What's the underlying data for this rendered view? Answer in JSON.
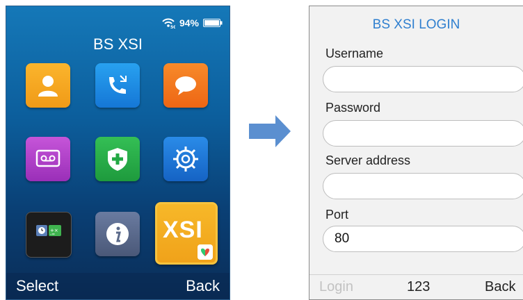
{
  "home": {
    "status": {
      "battery_percent": "94%",
      "network_label": "5G"
    },
    "title": "BS XSI",
    "apps": [
      {
        "name": "contacts-app",
        "icon": "contacts-icon",
        "color": "#f4a91e"
      },
      {
        "name": "call-history-app",
        "icon": "call-history-icon",
        "color": "#1b8de3"
      },
      {
        "name": "messages-app",
        "icon": "messages-icon",
        "color": "#f2751d"
      },
      {
        "name": "voicemail-app",
        "icon": "voicemail-icon",
        "color": "#b040c8"
      },
      {
        "name": "emergency-app",
        "icon": "shield-plus-icon",
        "color": "#2fb14c"
      },
      {
        "name": "settings-app",
        "icon": "gear-icon",
        "color": "#1e7bd8"
      },
      {
        "name": "tools-app",
        "icon": "clock-calculator-icon",
        "color": "#1a1a1a"
      },
      {
        "name": "info-app",
        "icon": "info-icon",
        "color": "#5b6a8a"
      }
    ],
    "xsi_app": {
      "label": "XSI",
      "icon": "xsi-icon"
    },
    "softkeys": {
      "left": "Select",
      "right": "Back"
    }
  },
  "login": {
    "title": "BS XSI LOGIN",
    "fields": [
      {
        "label": "Username",
        "value": ""
      },
      {
        "label": "Password",
        "value": ""
      },
      {
        "label": "Server address",
        "value": ""
      },
      {
        "label": "Port",
        "value": "80"
      }
    ],
    "softkeys": {
      "left": "Login",
      "middle": "123",
      "right": "Back"
    }
  },
  "colors": {
    "accent": "#2f7fcf",
    "arrow": "#5b8fd0",
    "xsi": "#f2a81e"
  }
}
